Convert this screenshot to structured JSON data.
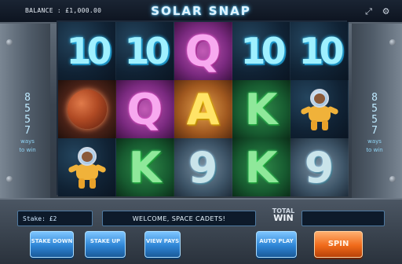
{
  "header": {
    "balance": "BALANCE : £1,000.00",
    "title": "SOLAR SNAP",
    "icons": [
      "fullscreen-icon",
      "settings-icon"
    ]
  },
  "ways": {
    "digits": [
      "8",
      "5",
      "5",
      "7"
    ],
    "label_1": "ways",
    "label_2": "to win"
  },
  "reels": {
    "rows": [
      [
        "10",
        "10",
        "Q",
        "10",
        "10"
      ],
      [
        "planet",
        "Q",
        "A",
        "K",
        "astronaut"
      ],
      [
        "astronaut",
        "K",
        "9",
        "K",
        "9"
      ]
    ]
  },
  "footer": {
    "stake": "Stake: £2",
    "message": "WELCOME, SPACE CADETS!",
    "total_win_label_1": "TOTAL",
    "total_win_label_2": "WIN",
    "total_win_value": "",
    "buttons": {
      "stake_down": "STAKE DOWN",
      "stake_up": "STAKE UP",
      "view_pays": "VIEW PAYS",
      "auto_play": "AUTO PLAY",
      "spin": "SPIN"
    }
  }
}
